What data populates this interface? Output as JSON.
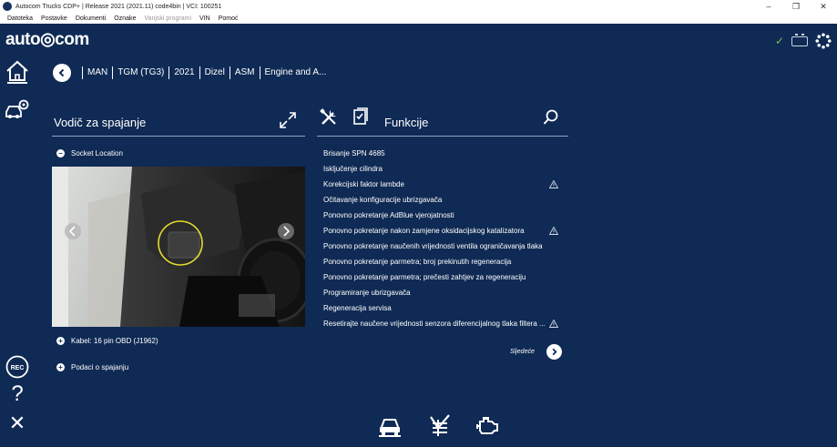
{
  "window": {
    "title": "Autocom Trucks CDP+ | Release 2021 (2021.11) code4bin | VCI: 100251",
    "minimize": "–",
    "maximize": "❐",
    "close": "✕"
  },
  "menu": {
    "items": [
      "Datoteka",
      "Postavke",
      "Dokumenti",
      "Oznake",
      "Vanjski programi",
      "VIN",
      "Pomoć"
    ]
  },
  "logo": "auto◎com",
  "breadcrumb": [
    "MAN",
    "TGM (TG3)",
    "2021",
    "Dizel",
    "ASM",
    "Engine and A..."
  ],
  "connection": {
    "title": "Vodič za spajanje",
    "socket_label": "Socket Location",
    "cable_label": "Kabel: 16 pin OBD (J1962)",
    "data_label": "Podaci o spajanju"
  },
  "functions": {
    "title": "Funkcije",
    "items": [
      {
        "label": "Brisanje SPN 4685",
        "warning": false
      },
      {
        "label": "Isključenje cilindra",
        "warning": false
      },
      {
        "label": "Korekcijski faktor lambde",
        "warning": true
      },
      {
        "label": "Očitavanje konfiguracije ubrizgavača",
        "warning": false
      },
      {
        "label": "Ponovno pokretanje AdBlue vjerojatnosti",
        "warning": false
      },
      {
        "label": "Ponovno pokretanje nakon zamjene oksidacijskog katalizatora",
        "warning": true
      },
      {
        "label": "Ponovno pokretanje naučenih vrijednosti ventila ograničavanja tlaka",
        "warning": false
      },
      {
        "label": "Ponovno pokretanje parmetra; broj prekinutih regeneracija",
        "warning": false
      },
      {
        "label": "Ponovno pokretanje parmetra; prečesti zahtjev za regeneraciju",
        "warning": false
      },
      {
        "label": "Programiranje ubrizgavača",
        "warning": false
      },
      {
        "label": "Regeneracija servisa",
        "warning": false
      },
      {
        "label": "Resetirajte naučene vrijednosti senzora diferencijalnog tlaka filtera ...",
        "warning": true
      }
    ],
    "next_label": "Sljedeće"
  },
  "sidebar": {
    "rec_label": "REC",
    "help_label": "?",
    "close_label": "✕"
  },
  "colors": {
    "background": "#0f2a54",
    "accent_green": "#7cc242",
    "divider": "#8fa3c2"
  }
}
